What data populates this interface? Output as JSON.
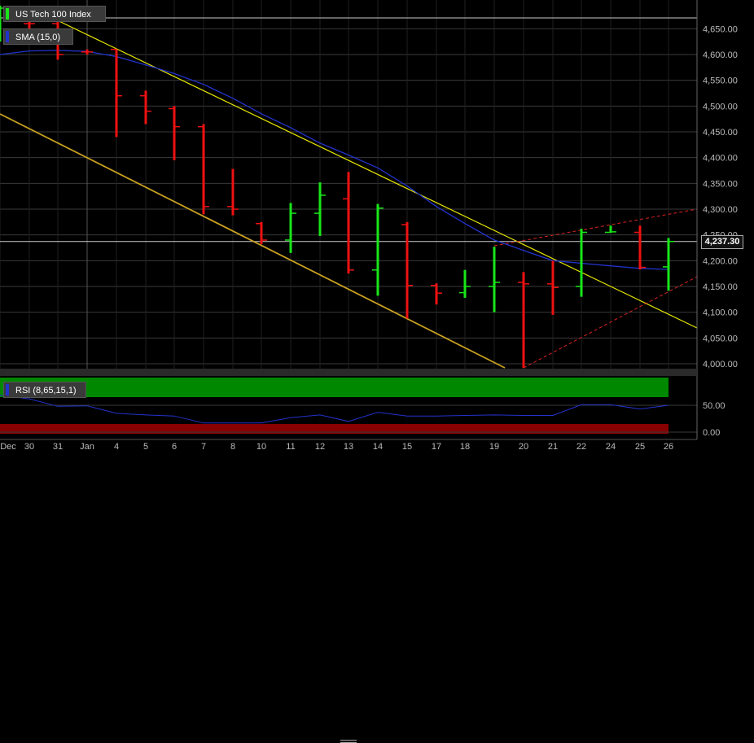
{
  "legend": {
    "title": "US Tech 100 Index",
    "sma_label": "SMA (15,0)",
    "rsi_label": "RSI (8,65,15,1)"
  },
  "current_price_label": "4,237.30",
  "colors": {
    "up": "#19e619",
    "down": "#ee1111",
    "sma": "#2233cc",
    "channel_upper": "#e6e600",
    "channel_lower": "#c8a020",
    "wedge": "#dd2222",
    "grid": "#3a3a3a",
    "rsi_upper_zone": "#008800",
    "rsi_lower_zone": "#880000",
    "rsi_line": "#2233cc"
  },
  "chart_data": [
    {
      "type": "candlestick",
      "title": "US Tech 100 Index",
      "x_tick_labels": [
        "Dec",
        "30",
        "31",
        "Jan",
        "4",
        "5",
        "6",
        "7",
        "8",
        "10",
        "11",
        "12",
        "13",
        "14",
        "15",
        "17",
        "18",
        "19",
        "20",
        "21",
        "22",
        "24",
        "25",
        "26"
      ],
      "y_tick_labels": [
        "4,000.00",
        "4,050.00",
        "4,100.00",
        "4,150.00",
        "4,200.00",
        "4,250.00",
        "4,300.00",
        "4,350.00",
        "4,400.00",
        "4,450.00",
        "4,500.00",
        "4,550.00",
        "4,600.00",
        "4,650.00"
      ],
      "ylim": [
        3990,
        4690
      ],
      "current_price": 4237.3,
      "bars": [
        {
          "x": "29",
          "open": 4655,
          "high": 4695,
          "low": 4625,
          "close": 4690,
          "dir": "up"
        },
        {
          "x": "30",
          "open": 4660,
          "high": 4665,
          "low": 4625,
          "close": 4660,
          "dir": "down"
        },
        {
          "x": "31",
          "open": 4660,
          "high": 4665,
          "low": 4590,
          "close": 4600,
          "dir": "down"
        },
        {
          "x": "3",
          "open": 4605,
          "high": 4610,
          "low": 4600,
          "close": 4605,
          "dir": "down"
        },
        {
          "x": "4",
          "open": 4610,
          "high": 4610,
          "low": 4440,
          "close": 4520,
          "dir": "down"
        },
        {
          "x": "5",
          "open": 4520,
          "high": 4530,
          "low": 4465,
          "close": 4490,
          "dir": "down"
        },
        {
          "x": "6",
          "open": 4495,
          "high": 4500,
          "low": 4395,
          "close": 4460,
          "dir": "down"
        },
        {
          "x": "7",
          "open": 4460,
          "high": 4465,
          "low": 4290,
          "close": 4305,
          "dir": "down"
        },
        {
          "x": "8",
          "open": 4305,
          "high": 4378,
          "low": 4288,
          "close": 4300,
          "dir": "down"
        },
        {
          "x": "10",
          "open": 4272,
          "high": 4275,
          "low": 4232,
          "close": 4240,
          "dir": "down"
        },
        {
          "x": "11",
          "open": 4240,
          "high": 4312,
          "low": 4215,
          "close": 4292,
          "dir": "up"
        },
        {
          "x": "12",
          "open": 4292,
          "high": 4352,
          "low": 4248,
          "close": 4327,
          "dir": "up"
        },
        {
          "x": "13",
          "open": 4320,
          "high": 4372,
          "low": 4175,
          "close": 4182,
          "dir": "down"
        },
        {
          "x": "14",
          "open": 4182,
          "high": 4310,
          "low": 4132,
          "close": 4302,
          "dir": "up"
        },
        {
          "x": "15",
          "open": 4270,
          "high": 4275,
          "low": 4088,
          "close": 4152,
          "dir": "down"
        },
        {
          "x": "17",
          "open": 4152,
          "high": 4156,
          "low": 4115,
          "close": 4137,
          "dir": "down"
        },
        {
          "x": "18",
          "open": 4138,
          "high": 4182,
          "low": 4128,
          "close": 4150,
          "dir": "up"
        },
        {
          "x": "19",
          "open": 4150,
          "high": 4227,
          "low": 4100,
          "close": 4158,
          "dir": "up"
        },
        {
          "x": "20",
          "open": 4158,
          "high": 4178,
          "low": 3992,
          "close": 4155,
          "dir": "down"
        },
        {
          "x": "21",
          "open": 4155,
          "high": 4200,
          "low": 4095,
          "close": 4148,
          "dir": "down"
        },
        {
          "x": "22",
          "open": 4150,
          "high": 4262,
          "low": 4130,
          "close": 4255,
          "dir": "up"
        },
        {
          "x": "24",
          "open": 4255,
          "high": 4268,
          "low": 4254,
          "close": 4256,
          "dir": "up"
        },
        {
          "x": "25",
          "open": 4255,
          "high": 4268,
          "low": 4183,
          "close": 4187,
          "dir": "down"
        },
        {
          "x": "26",
          "open": 4188,
          "high": 4244,
          "low": 4142,
          "close": 4237.3,
          "dir": "up"
        }
      ],
      "sma": {
        "name": "SMA (15,0)",
        "values": [
          4600,
          4607,
          4608,
          4606,
          4596,
          4580,
          4563,
          4542,
          4515,
          4485,
          4458,
          4428,
          4405,
          4380,
          4345,
          4305,
          4272,
          4240,
          4220,
          4200,
          4195,
          4190,
          4185,
          4183
        ]
      }
    },
    {
      "type": "line",
      "title": "RSI (8,65,15,1)",
      "y_tick_labels": [
        "0.00",
        "50.00"
      ],
      "ylim": [
        -5,
        95
      ],
      "series": [
        {
          "name": "RSI (8,65,15,1)",
          "values": [
            69,
            62,
            48,
            49,
            35,
            32,
            30,
            17,
            17,
            17,
            27,
            32,
            20,
            37,
            30,
            30,
            31,
            32,
            31,
            31,
            51,
            51,
            43,
            50
          ]
        }
      ]
    }
  ]
}
